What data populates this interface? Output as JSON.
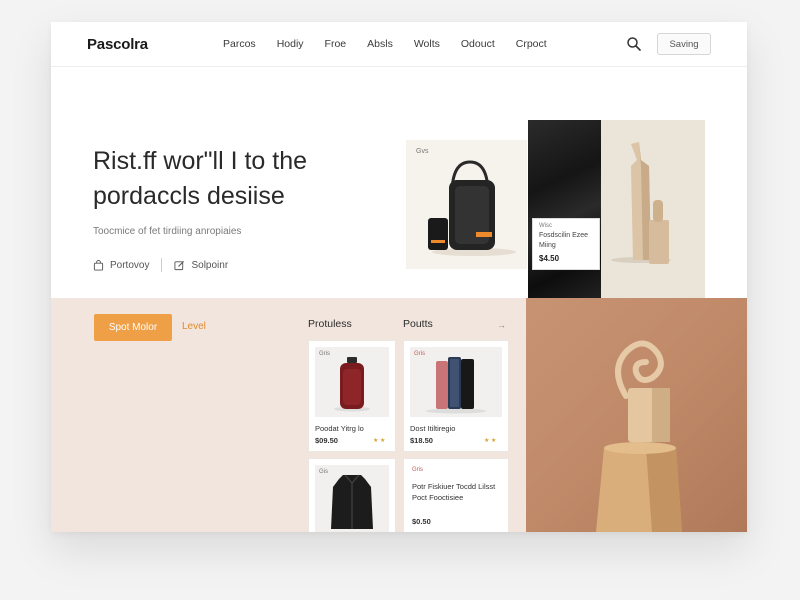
{
  "header": {
    "logo": "Pascolra",
    "nav": [
      "Parcos",
      "Hodiy",
      "Froe",
      "Absls",
      "Wolts",
      "Odouct",
      "Crpoct"
    ],
    "search_icon": "search-icon",
    "save_label": "Saving"
  },
  "hero": {
    "title_line1": "Rist.ff wor\"ll I to the",
    "title_line2": "pordaccls desiise",
    "subtitle": "Toocmice of fet tirdiing anropiaies",
    "link1": "Portovoy",
    "link2": "Solpoinr"
  },
  "tiles": {
    "headphone_label": "Gvs",
    "fabric_card": {
      "tag": "Wisc",
      "name": "Fosdscilin Ezee Miing",
      "price": "$4.50"
    }
  },
  "lower": {
    "shop_button": "Spot Molor",
    "level_link": "Level",
    "products_title": "Protuless",
    "products_title2": "Poutts",
    "arrow": "→"
  },
  "products": [
    {
      "tag": "Gris",
      "name": "Poodat Yitrg lo",
      "price": "$09.50",
      "rating": "★ ★"
    },
    {
      "tag": "Gris",
      "name": "Dost Itiltiregio",
      "price": "$18.50",
      "rating": "★ ★"
    },
    {
      "tag": "Gis",
      "name": "",
      "price": "",
      "rating": ""
    },
    {
      "tag": "Gris",
      "name": "Potr Fiskiuer Tocdd Lilsst Poct Fooctisiee",
      "price": "$0.50",
      "rating": ""
    }
  ],
  "colors": {
    "accent": "#ef9f46",
    "lower_bg": "#f1e5dd",
    "brown_panel": "#c08a69"
  }
}
